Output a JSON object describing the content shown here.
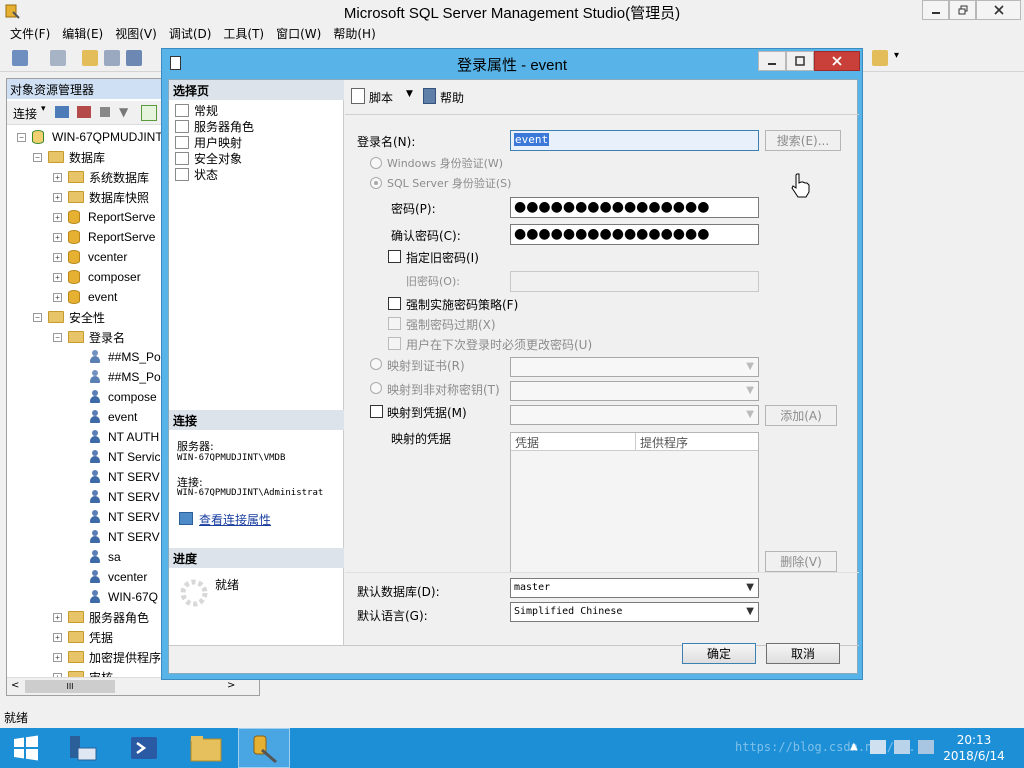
{
  "app": {
    "title": "Microsoft SQL Server Management Studio(管理员)",
    "caption_buttons": [
      "minimize-icon",
      "restore-icon",
      "close-icon"
    ]
  },
  "menu": [
    "文件(F)",
    "编辑(E)",
    "视图(V)",
    "调试(D)",
    "工具(T)",
    "窗口(W)",
    "帮助(H)"
  ],
  "object_explorer": {
    "title": "对象资源管理器",
    "connect_label": "连接",
    "tree": [
      {
        "label": "WIN-67QPMUDJINT",
        "level": 0,
        "expander": "−",
        "icon": "server-icon"
      },
      {
        "label": "数据库",
        "level": 1,
        "expander": "−",
        "icon": "folder-icon"
      },
      {
        "label": "系统数据库",
        "level": 2,
        "expander": "+",
        "icon": "folder-icon"
      },
      {
        "label": "数据库快照",
        "level": 2,
        "expander": "+",
        "icon": "folder-icon"
      },
      {
        "label": "ReportServe",
        "level": 2,
        "expander": "+",
        "icon": "database-icon"
      },
      {
        "label": "ReportServe",
        "level": 2,
        "expander": "+",
        "icon": "database-icon"
      },
      {
        "label": "vcenter",
        "level": 2,
        "expander": "+",
        "icon": "database-icon"
      },
      {
        "label": "composer",
        "level": 2,
        "expander": "+",
        "icon": "database-icon"
      },
      {
        "label": "event",
        "level": 2,
        "expander": "+",
        "icon": "database-icon"
      },
      {
        "label": "安全性",
        "level": 1,
        "expander": "−",
        "icon": "folder-icon"
      },
      {
        "label": "登录名",
        "level": 2,
        "expander": "−",
        "icon": "folder-icon"
      },
      {
        "label": "##MS_Po",
        "level": 3,
        "expander": "",
        "icon": "login-disabled-icon"
      },
      {
        "label": "##MS_Po",
        "level": 3,
        "expander": "",
        "icon": "login-disabled-icon"
      },
      {
        "label": "compose",
        "level": 3,
        "expander": "",
        "icon": "login-icon"
      },
      {
        "label": "event",
        "level": 3,
        "expander": "",
        "icon": "login-icon"
      },
      {
        "label": "NT AUTH",
        "level": 3,
        "expander": "",
        "icon": "login-icon"
      },
      {
        "label": "NT Servic",
        "level": 3,
        "expander": "",
        "icon": "login-icon"
      },
      {
        "label": "NT SERV",
        "level": 3,
        "expander": "",
        "icon": "login-icon"
      },
      {
        "label": "NT SERV",
        "level": 3,
        "expander": "",
        "icon": "login-icon"
      },
      {
        "label": "NT SERV",
        "level": 3,
        "expander": "",
        "icon": "login-icon"
      },
      {
        "label": "NT SERV",
        "level": 3,
        "expander": "",
        "icon": "login-icon"
      },
      {
        "label": "sa",
        "level": 3,
        "expander": "",
        "icon": "login-icon"
      },
      {
        "label": "vcenter",
        "level": 3,
        "expander": "",
        "icon": "login-icon"
      },
      {
        "label": "WIN-67Q",
        "level": 3,
        "expander": "",
        "icon": "login-icon"
      },
      {
        "label": "服务器角色",
        "level": 2,
        "expander": "+",
        "icon": "folder-icon"
      },
      {
        "label": "凭据",
        "level": 2,
        "expander": "+",
        "icon": "folder-icon"
      },
      {
        "label": "加密提供程序",
        "level": 2,
        "expander": "+",
        "icon": "folder-icon"
      },
      {
        "label": "审核",
        "level": 2,
        "expander": "+",
        "icon": "folder-icon"
      }
    ],
    "hscroll_thumb": "III"
  },
  "status_bar": {
    "text": "就绪"
  },
  "taskbar": {
    "time": "20:13",
    "date": "2018/6/14",
    "watermark": "https://blog.csdn.net/..."
  },
  "dialog": {
    "title": "登录属性 - event",
    "select_page_header": "选择页",
    "pages": [
      "常规",
      "服务器角色",
      "用户映射",
      "安全对象",
      "状态"
    ],
    "connection_header": "连接",
    "server_label": "服务器:",
    "server_value": "WIN-67QPMUDJINT\\VMDB",
    "conn_label": "连接:",
    "conn_value": "WIN-67QPMUDJINT\\Administrat",
    "view_conn_props": "查看连接属性",
    "progress_header": "进度",
    "progress_status": "就绪",
    "toolbar": {
      "script": "脚本",
      "help": "帮助"
    },
    "form": {
      "login_name_label": "登录名(N):",
      "login_name_value": "event",
      "search_button": "搜索(E)...",
      "windows_auth": "Windows 身份验证(W)",
      "sql_auth": "SQL Server 身份验证(S)",
      "password_label": "密码(P):",
      "password_value": "●●●●●●●●●●●●●●●●",
      "confirm_label": "确认密码(C):",
      "confirm_value": "●●●●●●●●●●●●●●●●",
      "specify_old": "指定旧密码(I)",
      "old_password_label": "旧密码(O):",
      "enforce_policy": "强制实施密码策略(F)",
      "enforce_expiration": "强制密码过期(X)",
      "must_change": "用户在下次登录时必须更改密码(U)",
      "map_cert": "映射到证书(R)",
      "map_asym_key": "映射到非对称密钥(T)",
      "map_credential": "映射到凭据(M)",
      "add_button": "添加(A)",
      "mapped_credentials_label": "映射的凭据",
      "cred_col": "凭据",
      "provider_col": "提供程序",
      "remove_button": "删除(V)",
      "default_db_label": "默认数据库(D):",
      "default_db_value": "master",
      "default_lang_label": "默认语言(G):",
      "default_lang_value": "Simplified Chinese"
    },
    "ok_button": "确定",
    "cancel_button": "取消"
  }
}
